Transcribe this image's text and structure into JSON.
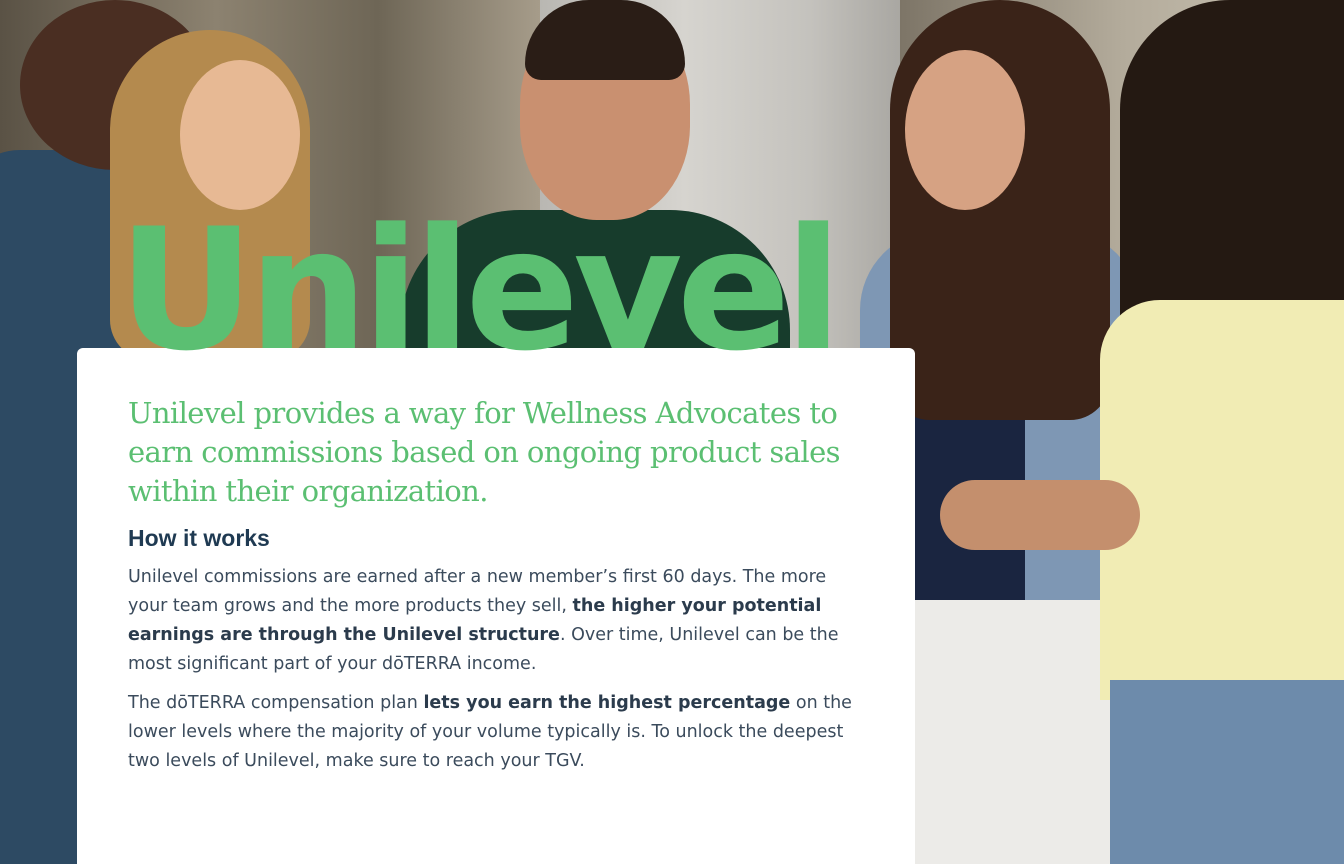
{
  "hero": {
    "title": "Unilevel",
    "image_alt": "Group of five friends laughing and talking outdoors"
  },
  "card": {
    "intro": "Unilevel provides a way for Wellness Advocates to earn commissions based on ongoing product sales within their organization.",
    "heading": "How it works",
    "para1": {
      "part1": "Unilevel commissions are earned after a new member’s first 60 days. The more your team grows and the more products they sell, ",
      "bold1": "the higher your potential earnings are through the Unilevel structure",
      "part2": ". Over time, Unilevel can be the most significant part of your dōTERRA income."
    },
    "para2": {
      "part1": "The dōTERRA compensation plan ",
      "bold1": "lets you earn the highest percentage",
      "part2": " on the lower levels where the majority of your volume typically is. To unlock the deepest two levels of Unilevel, make sure to reach your TGV."
    }
  },
  "colors": {
    "accent_green": "#5bbf72",
    "heading_navy": "#1f3a52",
    "body_text": "#3b4b5c"
  }
}
